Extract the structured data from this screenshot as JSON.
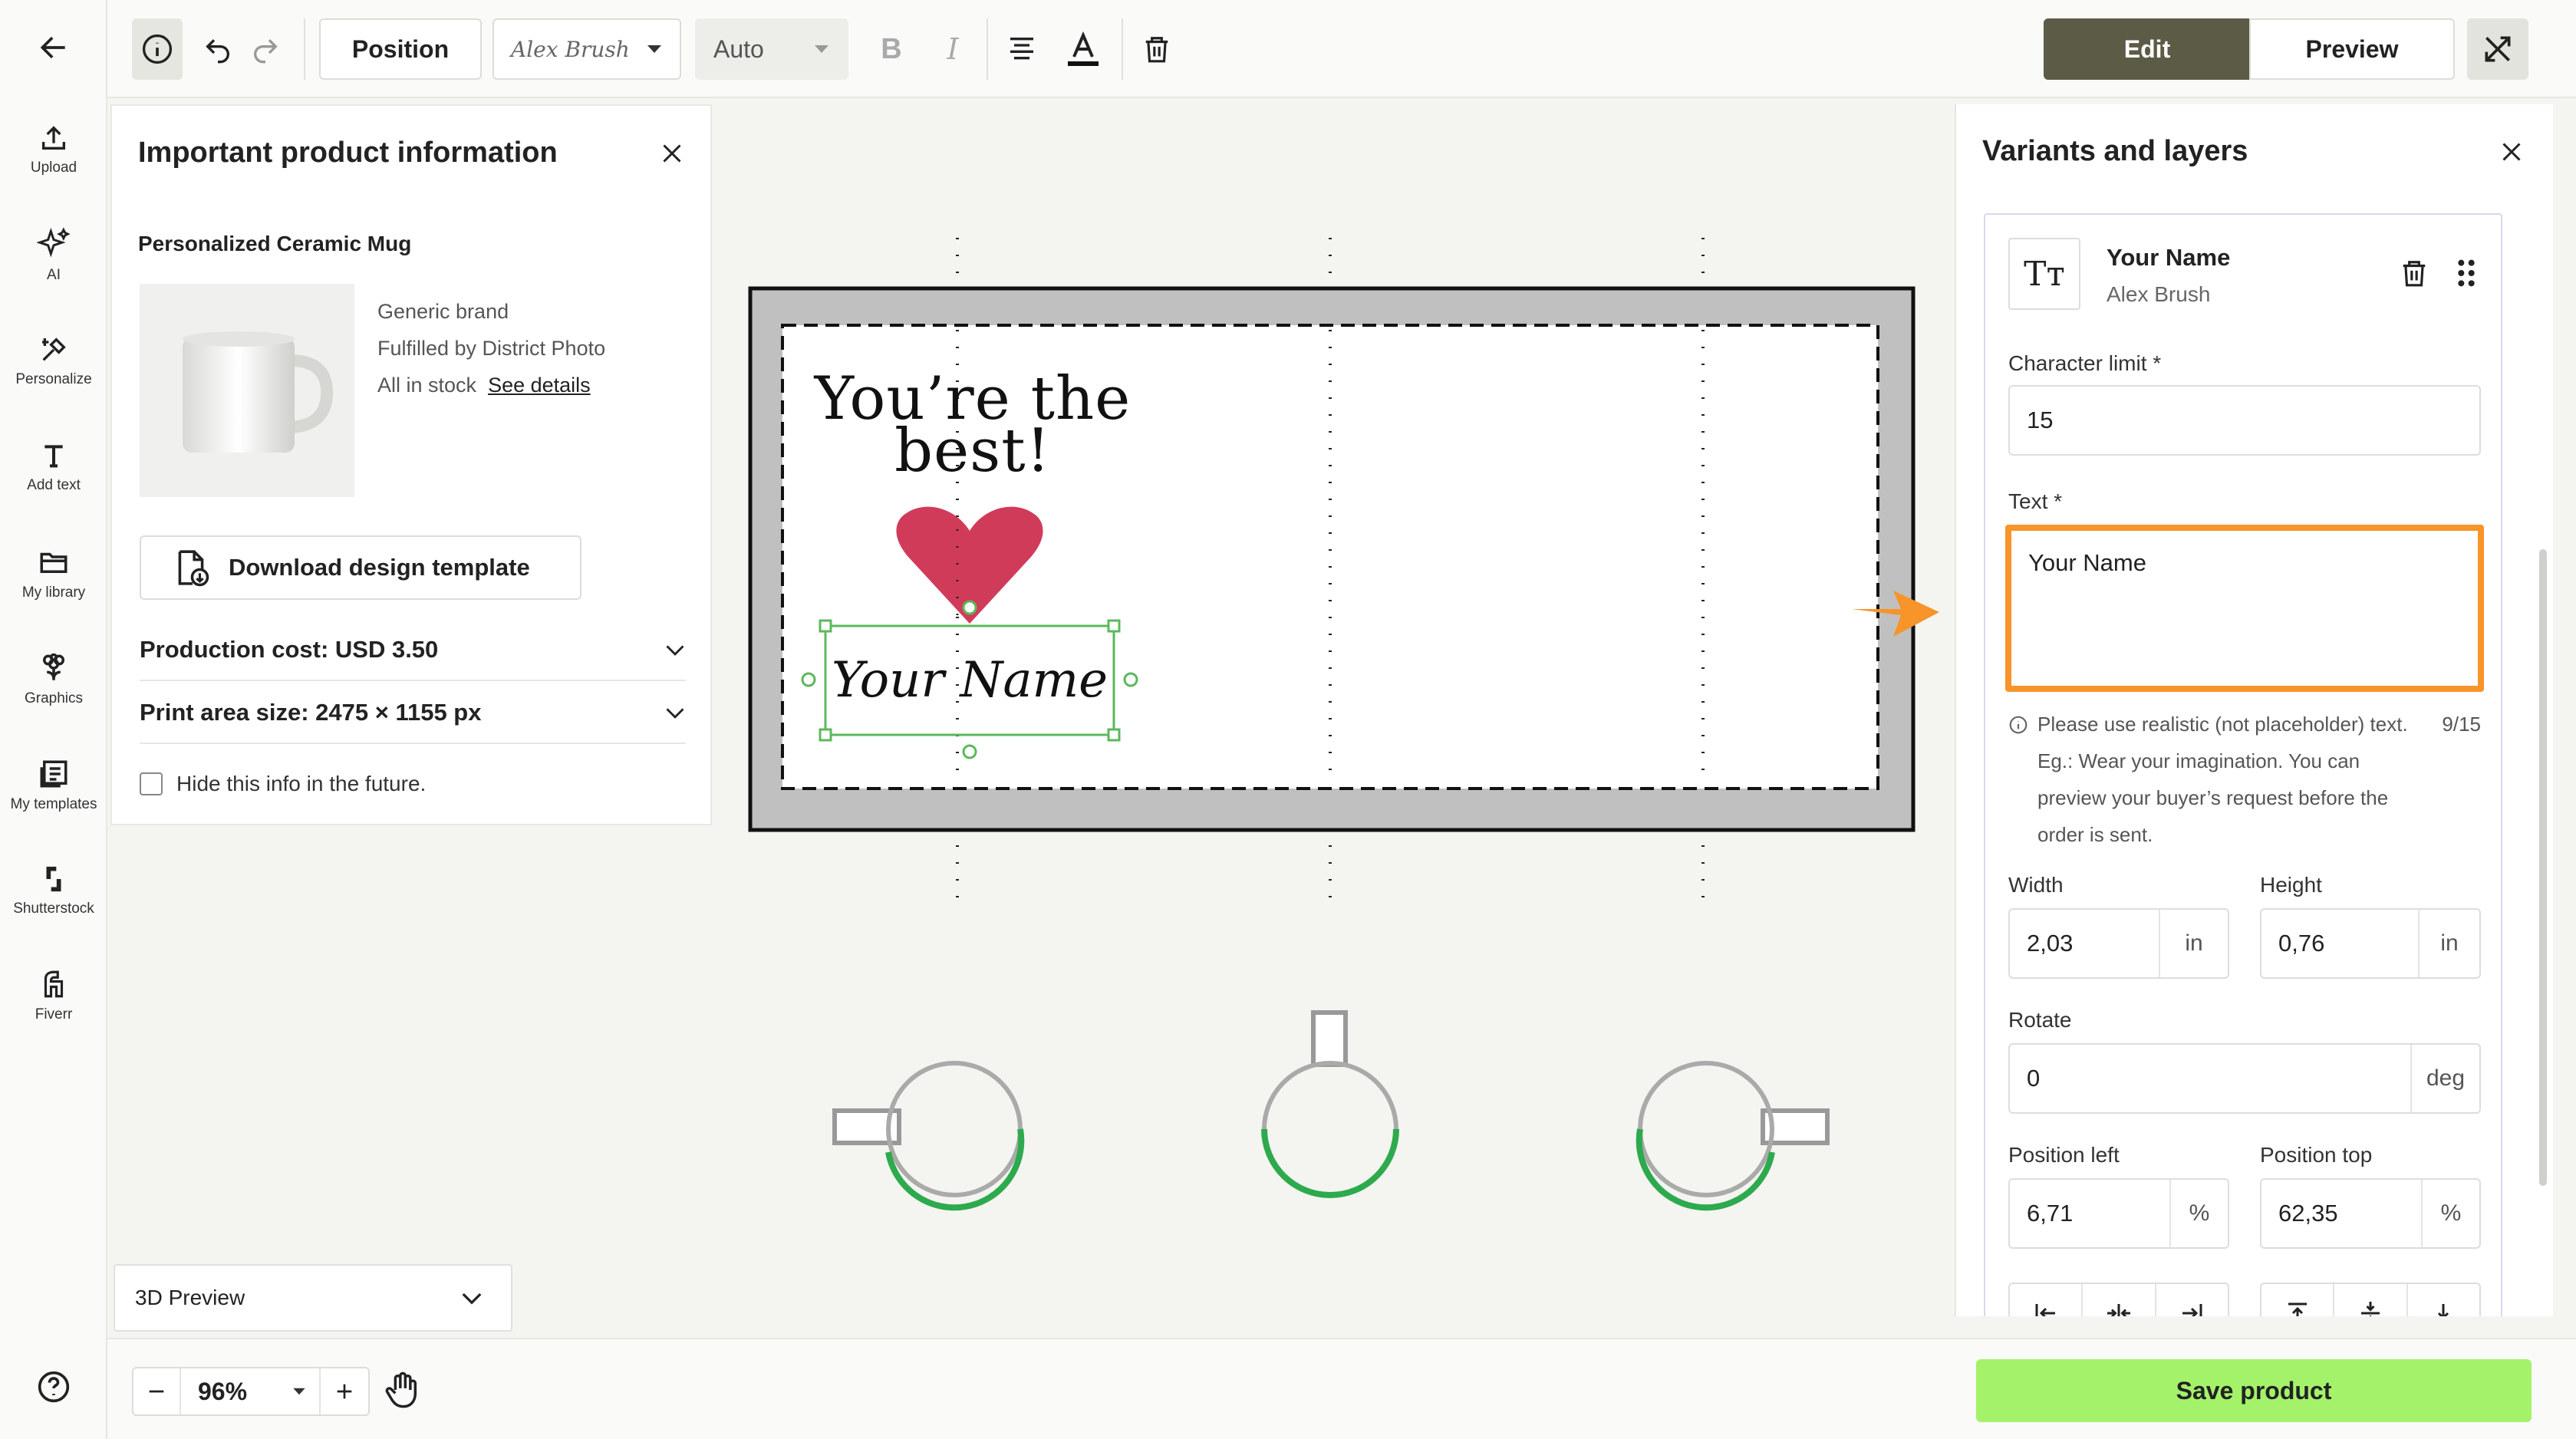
{
  "rail": {
    "items": [
      {
        "label": "Upload"
      },
      {
        "label": "AI"
      },
      {
        "label": "Personalize"
      },
      {
        "label": "Add text"
      },
      {
        "label": "My library"
      },
      {
        "label": "Graphics"
      },
      {
        "label": "My templates"
      },
      {
        "label": "Shutterstock"
      },
      {
        "label": "Fiverr"
      }
    ]
  },
  "toolbar": {
    "position_label": "Position",
    "font_name": "Alex Brush",
    "size_value": "Auto",
    "bold_label": "B",
    "italic_label": "I",
    "edit_label": "Edit",
    "preview_label": "Preview"
  },
  "info_panel": {
    "title": "Important product information",
    "product_name": "Personalized Ceramic Mug",
    "brand": "Generic brand",
    "fulfilled": "Fulfilled by District Photo",
    "stock": "All in stock",
    "details_link": "See details",
    "download_label": "Download design template",
    "production_cost": "Production cost: USD 3.50",
    "print_area": "Print area size: 2475 × 1155 px",
    "hide_label": "Hide this info in the future."
  },
  "canvas": {
    "headline": "You’re the best!",
    "name_text": "Your Name",
    "heart_color": "#d13b5a",
    "selection_color": "#5cb85c",
    "progress_color": "#2eaa4e"
  },
  "preview_select": {
    "value": "3D Preview"
  },
  "zoom": {
    "value": "96%"
  },
  "right_panel": {
    "title": "Variants and layers",
    "layer_name": "Your Name",
    "layer_font": "Alex Brush",
    "layer_icon_text": "Tт",
    "char_limit_label": "Character limit *",
    "char_limit_value": "15",
    "text_label": "Text *",
    "text_value": "Your Name",
    "hint": "Please use realistic (not placeholder) text. Eg.: Wear your imagination. You can preview your buyer’s request before the order is sent.",
    "counter": "9/15",
    "width_label": "Width",
    "width_value": "2,03",
    "height_label": "Height",
    "height_value": "0,76",
    "unit_in": "in",
    "rotate_label": "Rotate",
    "rotate_value": "0",
    "unit_deg": "deg",
    "pos_left_label": "Position left",
    "pos_left_value": "6,71",
    "pos_top_label": "Position top",
    "pos_top_value": "62,35",
    "unit_pct": "%"
  },
  "save_label": "Save product",
  "colors": {
    "accent_dark": "#5c5b45",
    "save_green": "#a4f26a",
    "highlight_orange": "#f7942a"
  }
}
